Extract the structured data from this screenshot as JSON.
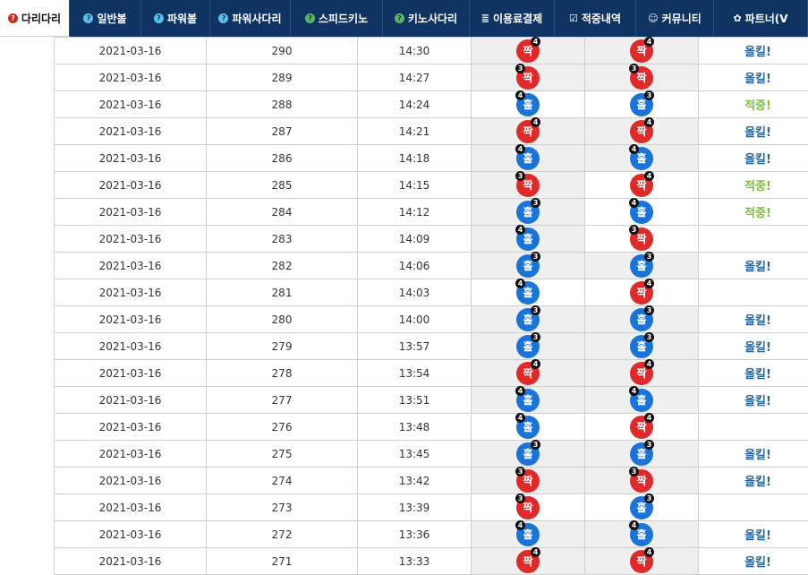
{
  "nav": [
    {
      "icon": "?",
      "label": "다리다리",
      "style": "red",
      "active": true
    },
    {
      "icon": "?",
      "label": "일반볼",
      "style": "blue"
    },
    {
      "icon": "?",
      "label": "파워볼",
      "style": "blue"
    },
    {
      "icon": "?",
      "label": "파워사다리",
      "style": "blue"
    },
    {
      "icon": "?",
      "label": "스피드키노",
      "style": "green"
    },
    {
      "icon": "?",
      "label": "키노사다리",
      "style": "green"
    },
    {
      "icon": "≣",
      "label": "이용료결제",
      "style": "plain"
    },
    {
      "icon": "☑",
      "label": "적중내역",
      "style": "plain"
    },
    {
      "icon": "☺",
      "label": "커뮤니티",
      "style": "plain"
    },
    {
      "icon": "✿",
      "label": "파트너(V",
      "style": "plain"
    }
  ],
  "rows": [
    {
      "date": "2021-03-16",
      "round": "290",
      "time": "14:30",
      "pick1": {
        "label": "짝",
        "color": "red",
        "num": "4",
        "side": "r"
      },
      "pick2": {
        "label": "짝",
        "color": "red",
        "num": "4",
        "side": "r"
      },
      "shade1": true,
      "shade2": true,
      "result": "올킬!",
      "result_type": "kill"
    },
    {
      "date": "2021-03-16",
      "round": "289",
      "time": "14:27",
      "pick1": {
        "label": "짝",
        "color": "red",
        "num": "3",
        "side": "l"
      },
      "pick2": {
        "label": "짝",
        "color": "red",
        "num": "3",
        "side": "l"
      },
      "shade1": true,
      "shade2": true,
      "result": "올킬!",
      "result_type": "kill"
    },
    {
      "date": "2021-03-16",
      "round": "288",
      "time": "14:24",
      "pick1": {
        "label": "홀",
        "color": "blue",
        "num": "4",
        "side": "l"
      },
      "pick2": {
        "label": "홀",
        "color": "blue",
        "num": "3",
        "side": "r"
      },
      "shade1": false,
      "shade2": false,
      "result": "적중!",
      "result_type": "hit"
    },
    {
      "date": "2021-03-16",
      "round": "287",
      "time": "14:21",
      "pick1": {
        "label": "짝",
        "color": "red",
        "num": "4",
        "side": "r"
      },
      "pick2": {
        "label": "짝",
        "color": "red",
        "num": "4",
        "side": "r"
      },
      "shade1": true,
      "shade2": true,
      "result": "올킬!",
      "result_type": "kill"
    },
    {
      "date": "2021-03-16",
      "round": "286",
      "time": "14:18",
      "pick1": {
        "label": "홀",
        "color": "blue",
        "num": "4",
        "side": "l"
      },
      "pick2": {
        "label": "홀",
        "color": "blue",
        "num": "4",
        "side": "l"
      },
      "shade1": true,
      "shade2": true,
      "result": "올킬!",
      "result_type": "kill"
    },
    {
      "date": "2021-03-16",
      "round": "285",
      "time": "14:15",
      "pick1": {
        "label": "짝",
        "color": "red",
        "num": "3",
        "side": "l"
      },
      "pick2": {
        "label": "짝",
        "color": "red",
        "num": "4",
        "side": "r"
      },
      "shade1": true,
      "shade2": false,
      "result": "적중!",
      "result_type": "hit"
    },
    {
      "date": "2021-03-16",
      "round": "284",
      "time": "14:12",
      "pick1": {
        "label": "홀",
        "color": "blue",
        "num": "3",
        "side": "r"
      },
      "pick2": {
        "label": "홀",
        "color": "blue",
        "num": "4",
        "side": "l"
      },
      "shade1": true,
      "shade2": false,
      "result": "적중!",
      "result_type": "hit"
    },
    {
      "date": "2021-03-16",
      "round": "283",
      "time": "14:09",
      "pick1": {
        "label": "홀",
        "color": "blue",
        "num": "4",
        "side": "l"
      },
      "pick2": {
        "label": "짝",
        "color": "red",
        "num": "3",
        "side": "l"
      },
      "shade1": true,
      "shade2": false,
      "result": "",
      "result_type": ""
    },
    {
      "date": "2021-03-16",
      "round": "282",
      "time": "14:06",
      "pick1": {
        "label": "홀",
        "color": "blue",
        "num": "3",
        "side": "r"
      },
      "pick2": {
        "label": "홀",
        "color": "blue",
        "num": "3",
        "side": "r"
      },
      "shade1": true,
      "shade2": true,
      "result": "올킬!",
      "result_type": "kill"
    },
    {
      "date": "2021-03-16",
      "round": "281",
      "time": "14:03",
      "pick1": {
        "label": "홀",
        "color": "blue",
        "num": "4",
        "side": "l"
      },
      "pick2": {
        "label": "짝",
        "color": "red",
        "num": "4",
        "side": "r"
      },
      "shade1": false,
      "shade2": false,
      "result": "",
      "result_type": ""
    },
    {
      "date": "2021-03-16",
      "round": "280",
      "time": "14:00",
      "pick1": {
        "label": "홀",
        "color": "blue",
        "num": "3",
        "side": "r"
      },
      "pick2": {
        "label": "홀",
        "color": "blue",
        "num": "3",
        "side": "r"
      },
      "shade1": true,
      "shade2": true,
      "result": "올킬!",
      "result_type": "kill"
    },
    {
      "date": "2021-03-16",
      "round": "279",
      "time": "13:57",
      "pick1": {
        "label": "홀",
        "color": "blue",
        "num": "3",
        "side": "r"
      },
      "pick2": {
        "label": "홀",
        "color": "blue",
        "num": "3",
        "side": "r"
      },
      "shade1": true,
      "shade2": true,
      "result": "올킬!",
      "result_type": "kill"
    },
    {
      "date": "2021-03-16",
      "round": "278",
      "time": "13:54",
      "pick1": {
        "label": "짝",
        "color": "red",
        "num": "4",
        "side": "r"
      },
      "pick2": {
        "label": "짝",
        "color": "red",
        "num": "4",
        "side": "r"
      },
      "shade1": true,
      "shade2": true,
      "result": "올킬!",
      "result_type": "kill"
    },
    {
      "date": "2021-03-16",
      "round": "277",
      "time": "13:51",
      "pick1": {
        "label": "홀",
        "color": "blue",
        "num": "4",
        "side": "l"
      },
      "pick2": {
        "label": "홀",
        "color": "blue",
        "num": "4",
        "side": "l"
      },
      "shade1": true,
      "shade2": true,
      "result": "올킬!",
      "result_type": "kill"
    },
    {
      "date": "2021-03-16",
      "round": "276",
      "time": "13:48",
      "pick1": {
        "label": "홀",
        "color": "blue",
        "num": "4",
        "side": "l"
      },
      "pick2": {
        "label": "짝",
        "color": "red",
        "num": "4",
        "side": "r"
      },
      "shade1": false,
      "shade2": false,
      "result": "",
      "result_type": ""
    },
    {
      "date": "2021-03-16",
      "round": "275",
      "time": "13:45",
      "pick1": {
        "label": "홀",
        "color": "blue",
        "num": "3",
        "side": "r"
      },
      "pick2": {
        "label": "홀",
        "color": "blue",
        "num": "3",
        "side": "r"
      },
      "shade1": true,
      "shade2": true,
      "result": "올킬!",
      "result_type": "kill"
    },
    {
      "date": "2021-03-16",
      "round": "274",
      "time": "13:42",
      "pick1": {
        "label": "짝",
        "color": "red",
        "num": "3",
        "side": "l"
      },
      "pick2": {
        "label": "짝",
        "color": "red",
        "num": "3",
        "side": "l"
      },
      "shade1": true,
      "shade2": true,
      "result": "올킬!",
      "result_type": "kill"
    },
    {
      "date": "2021-03-16",
      "round": "273",
      "time": "13:39",
      "pick1": {
        "label": "짝",
        "color": "red",
        "num": "3",
        "side": "l"
      },
      "pick2": {
        "label": "홀",
        "color": "blue",
        "num": "3",
        "side": "r"
      },
      "shade1": false,
      "shade2": false,
      "result": "",
      "result_type": ""
    },
    {
      "date": "2021-03-16",
      "round": "272",
      "time": "13:36",
      "pick1": {
        "label": "홀",
        "color": "blue",
        "num": "4",
        "side": "l"
      },
      "pick2": {
        "label": "홀",
        "color": "blue",
        "num": "4",
        "side": "l"
      },
      "shade1": true,
      "shade2": true,
      "result": "올킬!",
      "result_type": "kill"
    },
    {
      "date": "2021-03-16",
      "round": "271",
      "time": "13:33",
      "pick1": {
        "label": "짝",
        "color": "red",
        "num": "4",
        "side": "r"
      },
      "pick2": {
        "label": "짝",
        "color": "red",
        "num": "4",
        "side": "r"
      },
      "shade1": true,
      "shade2": true,
      "result": "올킬!",
      "result_type": "kill"
    }
  ]
}
